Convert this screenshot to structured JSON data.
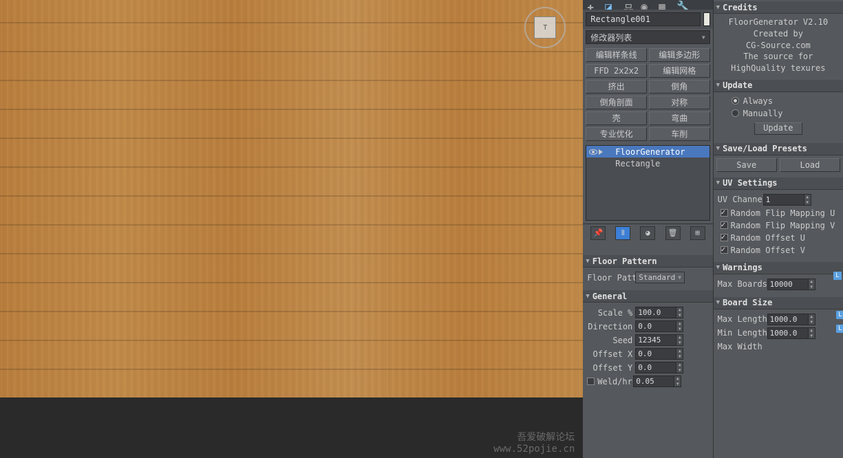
{
  "viewport": {
    "viewcube_label": "T",
    "watermark_line1": "吾爱破解论坛",
    "watermark_line2": "www.52pojie.cn"
  },
  "object_name": "Rectangle001",
  "modifier_dropdown": "修改器列表",
  "modifier_buttons": [
    "编辑样条线",
    "编辑多边形",
    "FFD 2x2x2",
    "编辑网格",
    "挤出",
    "倒角",
    "倒角剖面",
    "对称",
    "壳",
    "弯曲",
    "专业优化",
    "车削"
  ],
  "stack": {
    "items": [
      {
        "label": "FloorGenerator",
        "selected": true,
        "eye": true
      },
      {
        "label": "Rectangle",
        "selected": false,
        "eye": false
      }
    ]
  },
  "floor_pattern": {
    "title": "Floor Pattern",
    "label": "Floor Patte",
    "value": "Standard"
  },
  "general": {
    "title": "General",
    "scale_label": "Scale %",
    "scale_value": "100.0",
    "direction_label": "Direction",
    "direction_value": "0.0",
    "seed_label": "Seed",
    "seed_value": "12345",
    "offsetx_label": "Offset X",
    "offsetx_value": "0.0",
    "offsety_label": "Offset Y",
    "offsety_value": "0.0",
    "weld_label": "Weld/hr.",
    "weld_value": "0.05"
  },
  "credits": {
    "title": "Credits",
    "line1": "FloorGenerator V2.10",
    "line2": "Created by",
    "line3": "CG-Source.com",
    "line4": "The source for",
    "line5": "HighQuality texures"
  },
  "update": {
    "title": "Update",
    "opt_always": "Always",
    "opt_manually": "Manually",
    "btn": "Update"
  },
  "presets": {
    "title": "Save/Load Presets",
    "save": "Save",
    "load": "Load"
  },
  "uv": {
    "title": "UV Settings",
    "channel_label": "UV Channel",
    "channel_value": "1",
    "opt1": "Random Flip Mapping U",
    "opt2": "Random Flip Mapping V",
    "opt3": "Random Offset U",
    "opt4": "Random Offset V"
  },
  "warnings": {
    "title": "Warnings",
    "max_boards_label": "Max Boards",
    "max_boards_value": "10000"
  },
  "board_size": {
    "title": "Board Size",
    "max_len_label": "Max Length",
    "max_len_value": "1000.0",
    "min_len_label": "Min Length",
    "min_len_value": "1000.0",
    "max_w_label": "Max Width"
  },
  "l_badge": "L"
}
